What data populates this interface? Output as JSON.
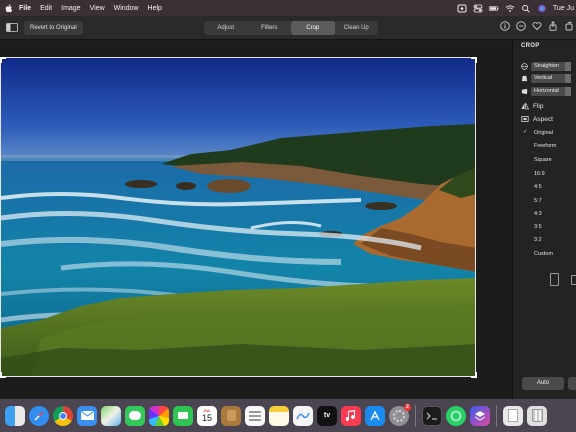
{
  "menubar": {
    "items": [
      "File",
      "Edit",
      "Image",
      "View",
      "Window",
      "Help"
    ],
    "clock": "Tue Ju"
  },
  "toolbar": {
    "revert_label": "Revert to Original",
    "tabs": [
      "Adjust",
      "Filters",
      "Crop",
      "Clean Up"
    ],
    "active_tab": "Crop"
  },
  "panel": {
    "title": "CROP",
    "controls": [
      "Straighten",
      "Vertical",
      "Horizontal"
    ],
    "flip_label": "Flip",
    "aspect_label": "Aspect",
    "aspects": [
      "Original",
      "Freeform",
      "Square",
      "16:9",
      "4:5",
      "5:7",
      "4:3",
      "3:5",
      "3:2",
      "Custom"
    ],
    "selected_aspect": "Original",
    "check_mark": "✓",
    "auto_label": "Auto"
  },
  "dock": {
    "calendar_day": "15",
    "calendar_month": "JUL",
    "appstore_badge": "2",
    "tv_label": "tv",
    "apps": [
      "finder",
      "safari",
      "chrome",
      "mail",
      "maps",
      "messages",
      "photos",
      "facetime",
      "calendar",
      "notes-brown",
      "reminders",
      "notes",
      "freeform",
      "tv",
      "music",
      "appstore",
      "settings",
      "terminal",
      "whatsapp",
      "shortcuts",
      "preview",
      "trash"
    ]
  },
  "colors": {
    "accent": "#0a84ff",
    "panel_bg": "#232323",
    "menubar_bg": "#3a3036",
    "dock_bg": "#4a4550"
  }
}
